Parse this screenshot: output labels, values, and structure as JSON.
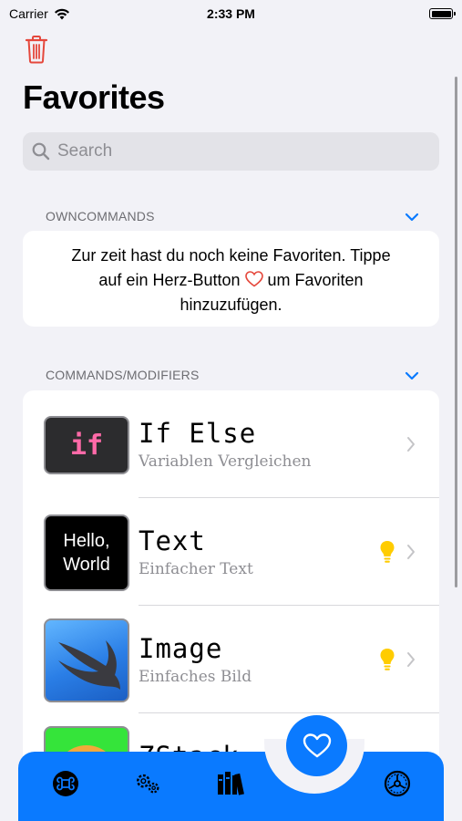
{
  "status_bar": {
    "carrier": "Carrier",
    "time": "2:33 PM"
  },
  "page": {
    "title": "Favorites",
    "search_placeholder": "Search"
  },
  "sections": {
    "owncommands": {
      "header": "OWNCOMMANDS",
      "empty_line1": "Zur zeit hast du noch keine Favoriten. Tippe",
      "empty_line2_pre": "auf ein Herz-Button",
      "empty_line2_post": "um Favoriten",
      "empty_line3": "hinzuzufügen."
    },
    "commands": {
      "header": "COMMANDS/MODIFIERS",
      "items": [
        {
          "title": "If Else",
          "subtitle": "Variablen Vergleichen",
          "thumb_text": "if"
        },
        {
          "title": "Text",
          "subtitle": "Einfacher Text",
          "thumb_text_1": "Hello,",
          "thumb_text_2": "World"
        },
        {
          "title": "Image",
          "subtitle": "Einfaches Bild"
        },
        {
          "title": "ZStack",
          "subtitle": ""
        }
      ]
    }
  },
  "tabbar": {
    "tabs": [
      "command-icon",
      "gears-icon",
      "library-icon",
      "favorites-heart-icon",
      "settings-icon"
    ]
  },
  "colors": {
    "accent": "#0a7aff",
    "destructive": "#e5483c",
    "bulb": "#ffcc00"
  }
}
